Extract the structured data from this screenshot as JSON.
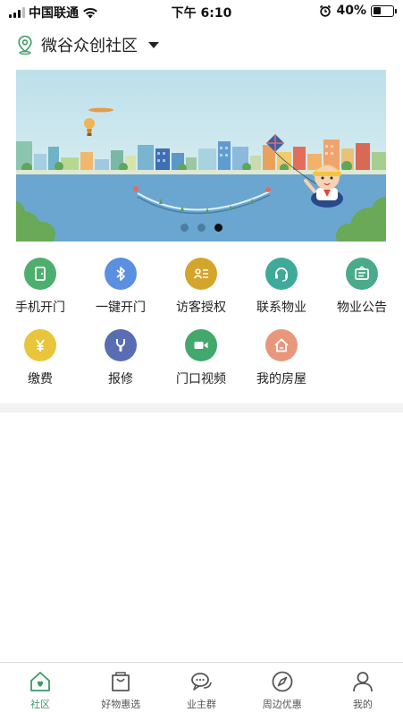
{
  "status_bar": {
    "carrier": "中国联通",
    "time": "下午 6:10",
    "battery_text": "40%",
    "battery_level": 0.4
  },
  "header": {
    "community_name": "微谷众创社区"
  },
  "banner": {
    "slide_count": 3,
    "active_index": 2
  },
  "services": [
    {
      "label": "手机开门",
      "icon": "door-icon",
      "color": "#4caf6e"
    },
    {
      "label": "一键开门",
      "icon": "bluetooth-icon",
      "color": "#5b8fe0"
    },
    {
      "label": "访客授权",
      "icon": "visitor-card-icon",
      "color": "#d4a52b"
    },
    {
      "label": "联系物业",
      "icon": "headset-icon",
      "color": "#3fa99a"
    },
    {
      "label": "物业公告",
      "icon": "notice-board-icon",
      "color": "#4baa8a"
    },
    {
      "label": "缴费",
      "icon": "yen-icon",
      "color": "#e8c53a"
    },
    {
      "label": "报修",
      "icon": "wrench-icon",
      "color": "#5a6db3"
    },
    {
      "label": "门口视频",
      "icon": "video-camera-icon",
      "color": "#43a86c"
    },
    {
      "label": "我的房屋",
      "icon": "house-icon",
      "color": "#e8977c"
    }
  ],
  "tabbar": {
    "items": [
      {
        "label": "社区",
        "icon": "home-heart-icon"
      },
      {
        "label": "好物惠选",
        "icon": "shopping-bag-icon"
      },
      {
        "label": "业主群",
        "icon": "chat-bubbles-icon"
      },
      {
        "label": "周边优惠",
        "icon": "compass-icon"
      },
      {
        "label": "我的",
        "icon": "user-icon"
      }
    ],
    "active_index": 0
  },
  "colors": {
    "accent": "#3a9a64",
    "banner_sky": "#d4ecf1",
    "banner_water": "#6aa6cf"
  }
}
